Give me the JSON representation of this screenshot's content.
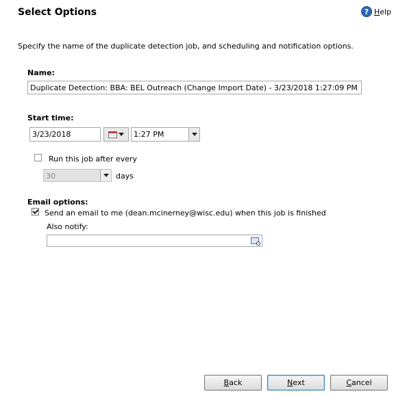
{
  "header": {
    "title": "Select Options",
    "help_label": "Help",
    "help_icon": "help-question-icon"
  },
  "description": "Specify the name of the duplicate detection job, and scheduling and notification options.",
  "name_section": {
    "label": "Name:",
    "value": "Duplicate Detection: BBA: BEL Outreach (Change Import Date) - 3/23/2018 1:27:09 PM"
  },
  "start_section": {
    "label": "Start time:",
    "date_value": "3/23/2018",
    "time_value": "1:27 PM"
  },
  "recurrence": {
    "checked": false,
    "label": "Run this job after every",
    "interval_value": "30",
    "unit_label": "days"
  },
  "email_section": {
    "label": "Email options:",
    "send_checked": true,
    "send_label": "Send an email to me (dean.mcinerney@wisc.edu) when this job is finished",
    "also_notify_label": "Also notify:",
    "also_notify_value": ""
  },
  "footer": {
    "back": "Back",
    "next": "Next",
    "cancel": "Cancel",
    "back_accel": "B",
    "back_rest": "ack",
    "next_accel": "N",
    "next_rest": "ext",
    "cancel_accel": "C",
    "cancel_rest": "ancel"
  }
}
